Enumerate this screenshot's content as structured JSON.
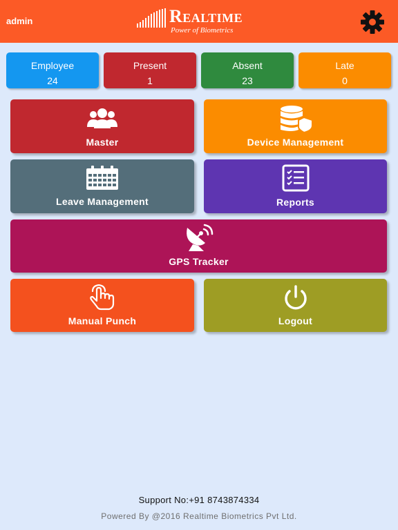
{
  "header": {
    "user": "admin",
    "logo_title": "Realtime",
    "logo_tagline": "Power of Biometrics",
    "settings_icon": "gear-icon"
  },
  "stats": [
    {
      "label": "Employee",
      "value": "24",
      "color": "#1497f0"
    },
    {
      "label": "Present",
      "value": "1",
      "color": "#c0282f"
    },
    {
      "label": "Absent",
      "value": "23",
      "color": "#2f8a3e"
    },
    {
      "label": "Late",
      "value": "0",
      "color": "#fb8c00"
    }
  ],
  "tiles": [
    {
      "label": "Master",
      "icon": "users-icon",
      "color": "#c0282f"
    },
    {
      "label": "Device Management",
      "icon": "database-shield-icon",
      "color": "#fb8c00"
    },
    {
      "label": "Leave Management",
      "icon": "calendar-icon",
      "color": "#546e7a"
    },
    {
      "label": "Reports",
      "icon": "checklist-icon",
      "color": "#5e35b1"
    },
    {
      "label": "GPS Tracker",
      "icon": "satellite-dish-icon",
      "color": "#ad1457"
    },
    {
      "label": "Manual Punch",
      "icon": "hand-pointer-icon",
      "color": "#f4511e"
    },
    {
      "label": "Logout",
      "icon": "power-icon",
      "color": "#9e9d24"
    }
  ],
  "footer": {
    "support": "Support No:+91 8743874334",
    "powered": "Powered By @2016 Realtime Biometrics Pvt Ltd."
  }
}
